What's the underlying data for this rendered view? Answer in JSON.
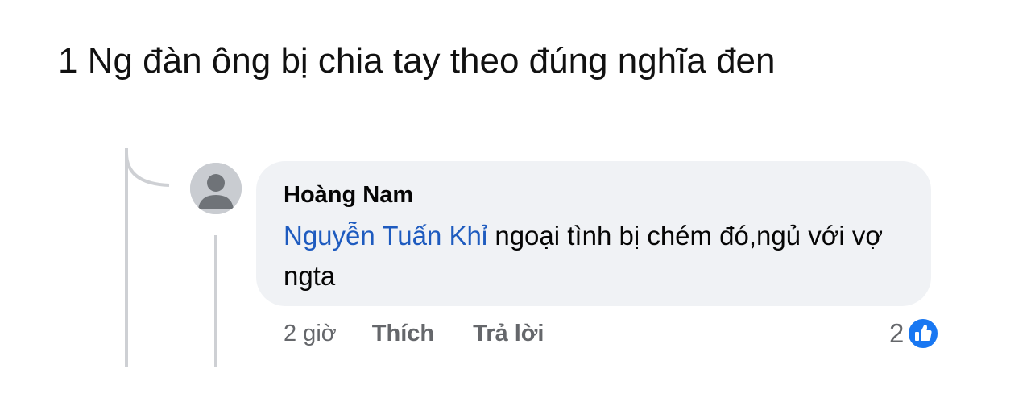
{
  "post": {
    "caption": "1 Ng đàn ông bị chia tay theo đúng nghĩa đen"
  },
  "comment": {
    "author": "Hoàng Nam",
    "mention": "Nguyễn Tuấn Khỉ",
    "text": " ngoại tình bị chém đó,ngủ với vợ ngta",
    "time": "2 giờ",
    "like_label": "Thích",
    "reply_label": "Trả lời",
    "reaction_count": "2",
    "reaction_icon": "like-icon",
    "avatar_icon": "default-avatar-icon"
  },
  "colors": {
    "mention": "#1e5bbf",
    "bubble": "#f0f2f5",
    "meta_text": "#65676b",
    "like_blue": "#1877f2",
    "thread_line": "#ced0d4"
  }
}
